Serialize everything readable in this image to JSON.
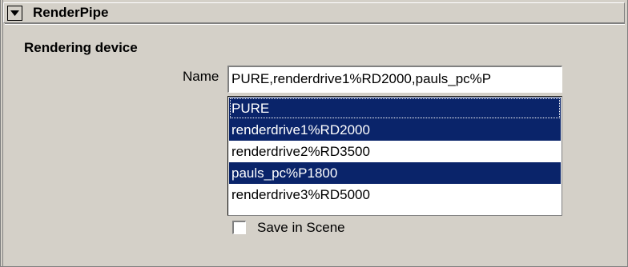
{
  "rollout": {
    "title": "RenderPipe",
    "collapse_icon": "triangle-down-icon"
  },
  "section": {
    "title": "Rendering device"
  },
  "name_field": {
    "label": "Name",
    "value": "PURE,renderdrive1%RD2000,pauls_pc%P"
  },
  "device_list": {
    "items": [
      {
        "label": "PURE",
        "selected": true,
        "focused": true
      },
      {
        "label": "renderdrive1%RD2000",
        "selected": true,
        "focused": false
      },
      {
        "label": "renderdrive2%RD3500",
        "selected": false,
        "focused": false
      },
      {
        "label": "pauls_pc%P1800",
        "selected": true,
        "focused": false
      },
      {
        "label": "renderdrive3%RD5000",
        "selected": false,
        "focused": false
      }
    ]
  },
  "save_in_scene": {
    "label": "Save in Scene",
    "checked": false
  },
  "colors": {
    "panel_bg": "#d4d0c8",
    "selection_bg": "#0a246a",
    "selection_text": "#ffffff"
  }
}
